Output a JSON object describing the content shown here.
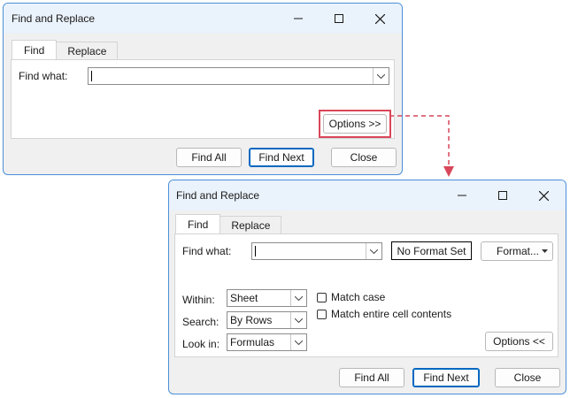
{
  "dialog1": {
    "title": "Find and Replace",
    "tabs": [
      "Find",
      "Replace"
    ],
    "find_what_label": "Find what:",
    "find_what_value": "",
    "options_button": "Options >>",
    "buttons": {
      "find_all": "Find All",
      "find_next": "Find Next",
      "close": "Close"
    }
  },
  "dialog2": {
    "title": "Find and Replace",
    "tabs": [
      "Find",
      "Replace"
    ],
    "find_what_label": "Find what:",
    "find_what_value": "",
    "no_format_set": "No Format Set",
    "format_button": "Format...",
    "within_label": "Within:",
    "within_value": "Sheet",
    "search_label": "Search:",
    "search_value": "By Rows",
    "look_in_label": "Look in:",
    "look_in_value": "Formulas",
    "match_case": "Match case",
    "match_entire": "Match entire cell contents",
    "options_button": "Options <<",
    "buttons": {
      "find_all": "Find All",
      "find_next": "Find Next",
      "close": "Close"
    }
  },
  "colors": {
    "highlight": "#d9475a",
    "accent": "#0067c0",
    "titlebar": "#eaf2fb",
    "dialog_bg": "#f0f0f0"
  }
}
